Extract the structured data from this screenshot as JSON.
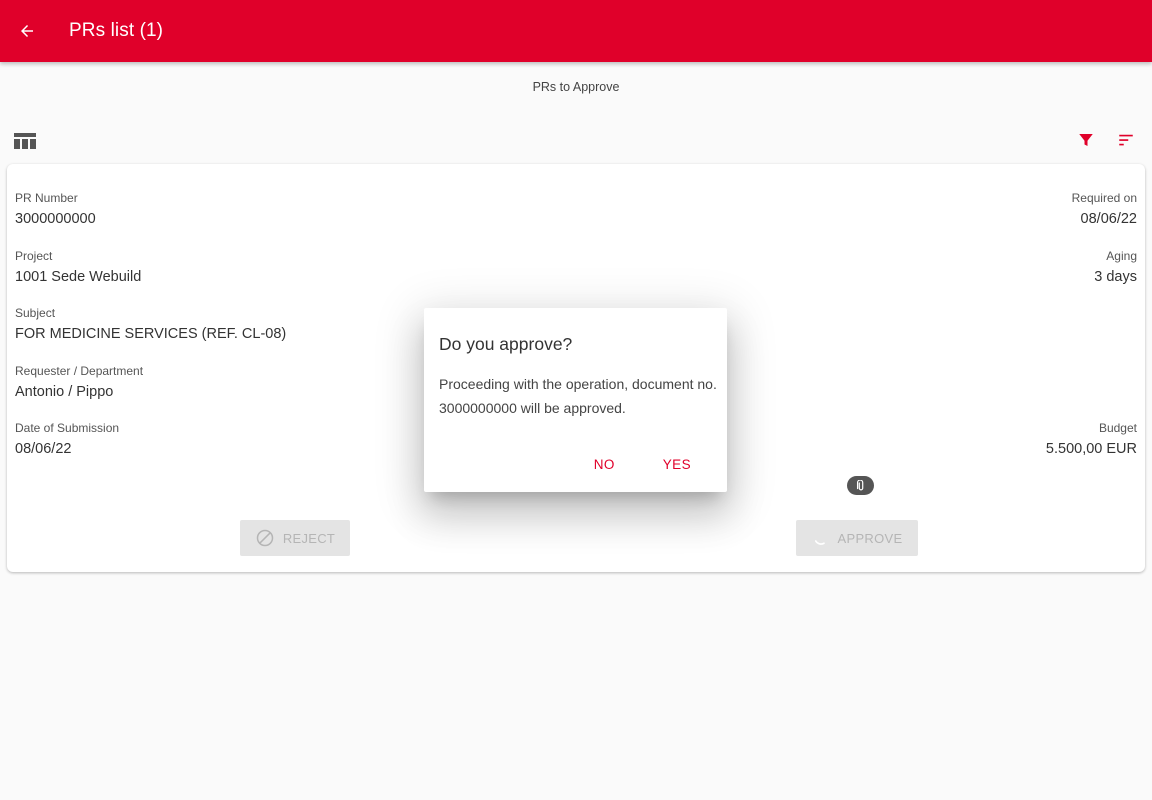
{
  "colors": {
    "brand": "#e0002a",
    "icon_gray": "#555555",
    "disabled_text": "#b5b5b5"
  },
  "header": {
    "title": "PRs list (1)",
    "back_icon": "arrow-left-icon"
  },
  "page": {
    "subtitle": "PRs to Approve"
  },
  "toolbar": {
    "layout_icon": "table-columns-icon",
    "filter_icon": "filter-icon",
    "sort_icon": "sort-icon"
  },
  "card": {
    "pr_number": {
      "label": "PR Number",
      "value": "3000000000"
    },
    "required_on": {
      "label": "Required on",
      "value": "08/06/22"
    },
    "project": {
      "label": "Project",
      "value": "1001 Sede Webuild"
    },
    "aging": {
      "label": "Aging",
      "value": "3 days"
    },
    "subject": {
      "label": "Subject",
      "value": "FOR MEDICINE SERVICES (REF. CL-08)"
    },
    "requester": {
      "label": "Requester / Department",
      "value": "Antonio / Pippo"
    },
    "submission": {
      "label": "Date of Submission",
      "value": "08/06/22"
    },
    "budget": {
      "label": "Budget",
      "value": "5.500,00 EUR"
    },
    "attachment_icon": "paperclip-icon",
    "reject_label": "REJECT",
    "approve_label": "APPROVE"
  },
  "dialog": {
    "title": "Do you approve?",
    "body": "Proceeding with the operation, document no. 3000000000 will be approved.",
    "no_label": "NO",
    "yes_label": "YES"
  }
}
